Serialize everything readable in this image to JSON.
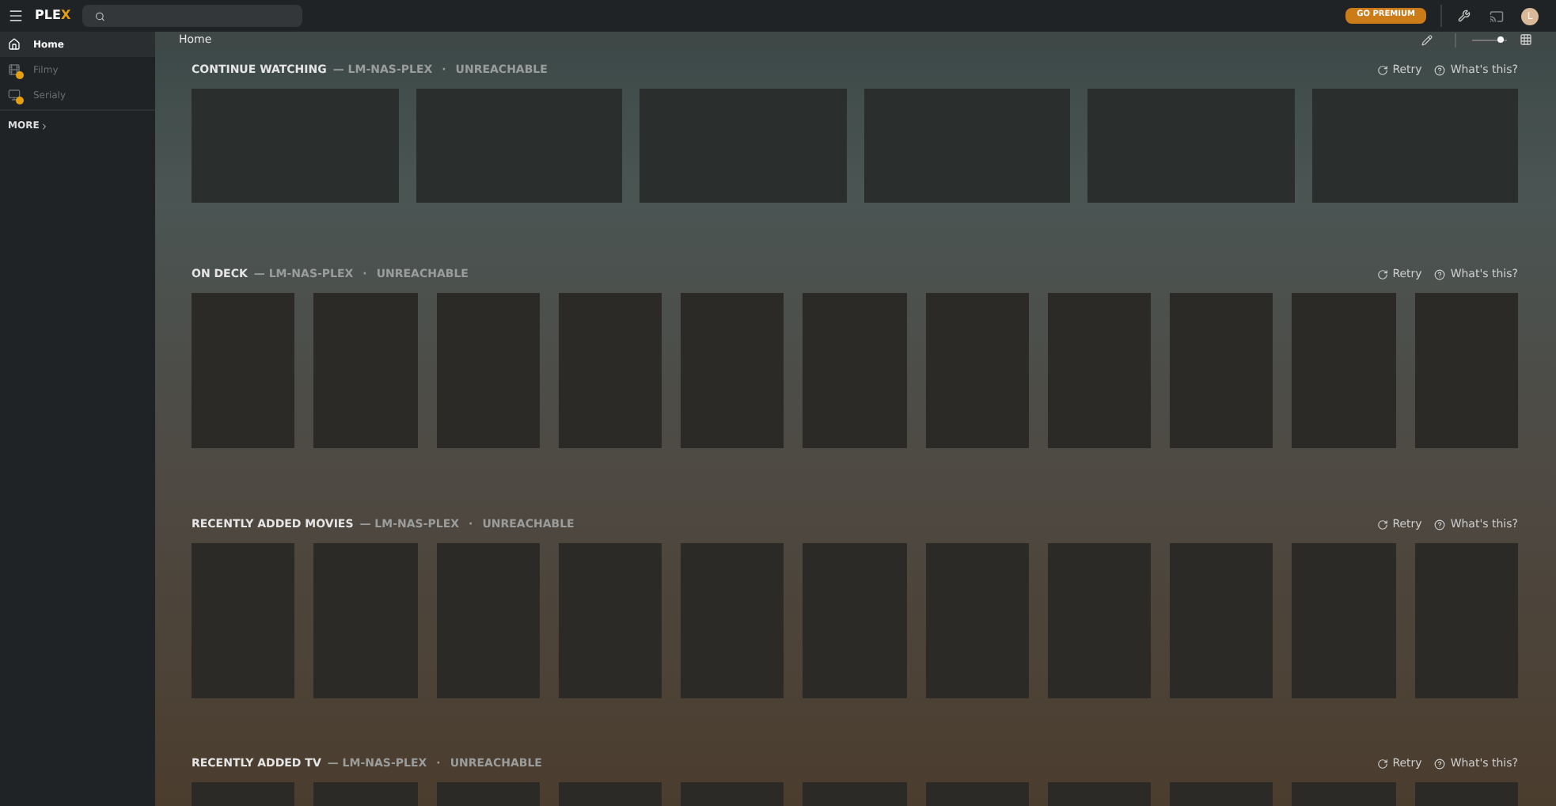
{
  "topbar": {
    "logo_start": "PLE",
    "logo_end": "X",
    "premium_button": "GO PREMIUM",
    "avatar": "L"
  },
  "sidebar": {
    "items": [
      {
        "label": "Home",
        "kind": "home",
        "selected": true,
        "disabled": false,
        "warning": false
      },
      {
        "label": "Filmy",
        "kind": "library",
        "selected": false,
        "disabled": true,
        "warning": true
      },
      {
        "label": "Serialy",
        "kind": "shows",
        "selected": false,
        "disabled": true,
        "warning": true
      }
    ],
    "more": "MORE"
  },
  "header": {
    "title": "Home",
    "zoom": {
      "level": 0.8
    }
  },
  "sections": [
    {
      "title": "CONTINUE WATCHING",
      "server": "— LM-NAS-PLEX",
      "separator": "·",
      "status": "UNREACHABLE",
      "retry": "Retry",
      "help": "What's this?",
      "kind": "wide",
      "tiles": [
        {
          "kind": "placeholder"
        },
        {
          "kind": "placeholder"
        },
        {
          "kind": "placeholder"
        },
        {
          "kind": "placeholder"
        },
        {
          "kind": "placeholder"
        },
        {
          "kind": "placeholder"
        }
      ]
    },
    {
      "title": "ON DECK",
      "server": "— LM-NAS-PLEX",
      "separator": "·",
      "status": "UNREACHABLE",
      "retry": "Retry",
      "help": "What's this?",
      "kind": "poster",
      "tiles": [
        {
          "kind": "placeholder"
        },
        {
          "kind": "placeholder"
        },
        {
          "kind": "placeholder"
        },
        {
          "kind": "placeholder"
        },
        {
          "kind": "placeholder"
        },
        {
          "kind": "placeholder"
        },
        {
          "kind": "placeholder"
        },
        {
          "kind": "placeholder"
        },
        {
          "kind": "placeholder"
        },
        {
          "kind": "placeholder"
        },
        {
          "kind": "placeholder"
        }
      ]
    },
    {
      "title": "RECENTLY ADDED MOVIES",
      "server": "— LM-NAS-PLEX",
      "separator": "·",
      "status": "UNREACHABLE",
      "retry": "Retry",
      "help": "What's this?",
      "kind": "poster",
      "tiles": [
        {
          "kind": "placeholder"
        },
        {
          "kind": "placeholder"
        },
        {
          "kind": "placeholder"
        },
        {
          "kind": "placeholder"
        },
        {
          "kind": "placeholder"
        },
        {
          "kind": "placeholder"
        },
        {
          "kind": "placeholder"
        },
        {
          "kind": "placeholder"
        },
        {
          "kind": "placeholder"
        },
        {
          "kind": "placeholder"
        },
        {
          "kind": "placeholder"
        }
      ]
    },
    {
      "title": "RECENTLY ADDED TV",
      "server": "— LM-NAS-PLEX",
      "separator": "·",
      "status": "UNREACHABLE",
      "retry": "Retry",
      "help": "What's this?",
      "kind": "poster",
      "tiles": [
        {
          "kind": "placeholder"
        },
        {
          "kind": "placeholder"
        },
        {
          "kind": "placeholder"
        },
        {
          "kind": "placeholder"
        },
        {
          "kind": "placeholder"
        },
        {
          "kind": "placeholder"
        },
        {
          "kind": "placeholder"
        },
        {
          "kind": "placeholder"
        },
        {
          "kind": "placeholder"
        },
        {
          "kind": "placeholder"
        },
        {
          "kind": "placeholder"
        }
      ]
    }
  ]
}
